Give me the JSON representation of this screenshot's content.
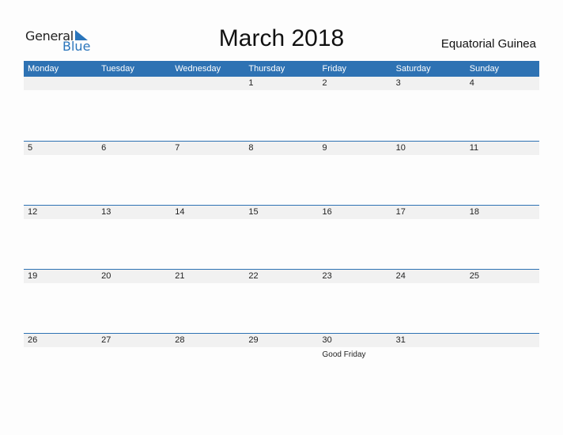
{
  "logo": {
    "word1": "General",
    "word2": "Blue"
  },
  "title": "March 2018",
  "country": "Equatorial Guinea",
  "colors": {
    "accent": "#2e72b3",
    "row_band": "#f1f1f1"
  },
  "weekdays": [
    "Monday",
    "Tuesday",
    "Wednesday",
    "Thursday",
    "Friday",
    "Saturday",
    "Sunday"
  ],
  "weeks": [
    [
      {
        "day": ""
      },
      {
        "day": ""
      },
      {
        "day": ""
      },
      {
        "day": "1"
      },
      {
        "day": "2"
      },
      {
        "day": "3"
      },
      {
        "day": "4"
      }
    ],
    [
      {
        "day": "5"
      },
      {
        "day": "6"
      },
      {
        "day": "7"
      },
      {
        "day": "8"
      },
      {
        "day": "9"
      },
      {
        "day": "10"
      },
      {
        "day": "11"
      }
    ],
    [
      {
        "day": "12"
      },
      {
        "day": "13"
      },
      {
        "day": "14"
      },
      {
        "day": "15"
      },
      {
        "day": "16"
      },
      {
        "day": "17"
      },
      {
        "day": "18"
      }
    ],
    [
      {
        "day": "19"
      },
      {
        "day": "20"
      },
      {
        "day": "21"
      },
      {
        "day": "22"
      },
      {
        "day": "23"
      },
      {
        "day": "24"
      },
      {
        "day": "25"
      }
    ],
    [
      {
        "day": "26"
      },
      {
        "day": "27"
      },
      {
        "day": "28"
      },
      {
        "day": "29"
      },
      {
        "day": "30",
        "event": "Good Friday"
      },
      {
        "day": "31"
      },
      {
        "day": ""
      }
    ]
  ]
}
